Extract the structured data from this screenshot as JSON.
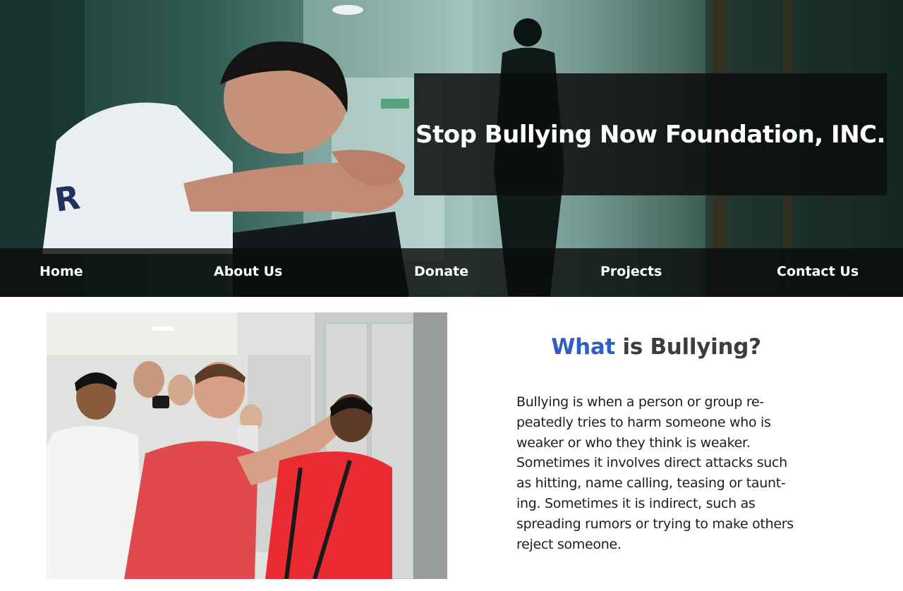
{
  "site": {
    "title": "Stop Bullying Now Foundation, INC."
  },
  "nav": {
    "items": [
      {
        "label": "Home"
      },
      {
        "label": "About Us"
      },
      {
        "label": "Donate"
      },
      {
        "label": "Projects"
      },
      {
        "label": "Contact Us"
      }
    ]
  },
  "section": {
    "heading_accent": "What",
    "heading_rest": " is Bullying?",
    "body_lines": [
      "Bullying is when a person or group re-",
      "peatedly tries to harm someone who is",
      "weaker or who they think is weaker.",
      "Sometimes it involves direct attacks such",
      "as hitting, name calling, teasing or taunt-",
      "ing. Sometimes it is indirect, such as",
      "spreading rumors or trying to make others",
      "reject someone."
    ]
  },
  "colors": {
    "accent_blue": "#2f5fc2",
    "heading_gray": "#3d3d3d",
    "overlay_dark": "#0c0e0e",
    "hero_teal": "#2f5a52",
    "shirt_red": "#e8343a"
  },
  "images": {
    "hero": "hallway-sad-teen-photo",
    "photo": "locker-bullying-photo"
  }
}
